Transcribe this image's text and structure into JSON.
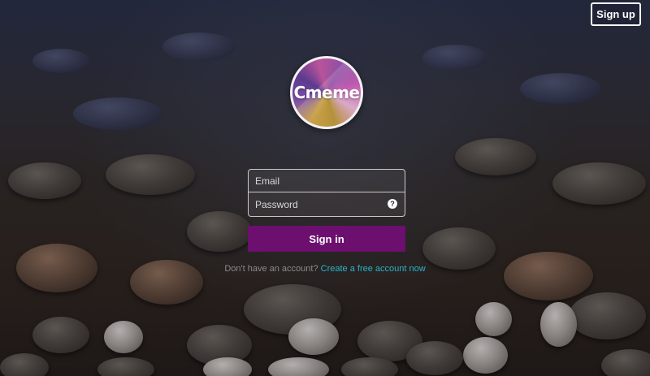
{
  "header": {
    "signup_label": "Sign up"
  },
  "logo": {
    "text": "Cmeme"
  },
  "login": {
    "email_placeholder": "Email",
    "password_placeholder": "Password",
    "help_symbol": "?",
    "signin_label": "Sign in"
  },
  "footer": {
    "prompt": "Don't have an account?",
    "link": "Create a free account now"
  },
  "colors": {
    "signin_button": "#6c0f6f",
    "link": "#2cb3c6"
  }
}
